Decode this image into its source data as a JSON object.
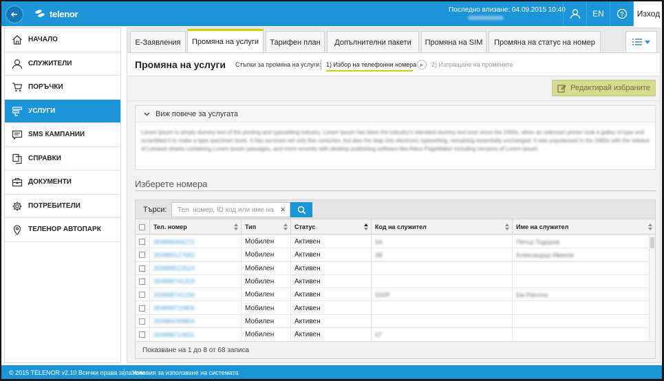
{
  "header": {
    "brand": "telenor",
    "last_login_label": "Последно влизане: 04.09.2015 10:40",
    "language": "EN",
    "logout_label": "Изход"
  },
  "sidebar": {
    "items": [
      {
        "label": "НАЧАЛО",
        "icon": "home-icon",
        "active": false
      },
      {
        "label": "СЛУЖИТЕЛИ",
        "icon": "user-icon",
        "active": false
      },
      {
        "label": "ПОРЪЧКИ",
        "icon": "cart-icon",
        "active": false
      },
      {
        "label": "УСЛУГИ",
        "icon": "services-icon",
        "active": true
      },
      {
        "label": "SMS КАМПАНИИ",
        "icon": "message-icon",
        "active": false
      },
      {
        "label": "СПРАВКИ",
        "icon": "documents-icon",
        "active": false
      },
      {
        "label": "ДОКУМЕНТИ",
        "icon": "briefcase-icon",
        "active": false
      },
      {
        "label": "ПОТРЕБИТЕЛИ",
        "icon": "gear-icon",
        "active": false
      },
      {
        "label": "ТЕЛЕНОР АВТОПАРК",
        "icon": "location-pin-icon",
        "active": false
      }
    ]
  },
  "tabs": [
    {
      "label": "Е-Заявления",
      "active": false
    },
    {
      "label": "Промяна на услуги",
      "active": true
    },
    {
      "label": "Тарифен план",
      "active": false
    },
    {
      "label": "Допълнителни пакети",
      "active": false
    },
    {
      "label": "Промяна на SIM",
      "active": false
    },
    {
      "label": "Промяна на статус на номер",
      "active": false
    }
  ],
  "page": {
    "title": "Промяна на услуги",
    "steps_label": "Стъпки за промяна на услуги:",
    "step1": "1) Избор на телефонни номера",
    "step2": "2) Изпращане на промените",
    "edit_button": "Редактирай избраните",
    "info_toggle": "Виж повече за услугата",
    "info_text": "Lorem Ipsum is simply dummy text of the printing and typesetting industry. Lorem Ipsum has been the industry's standard dummy text ever since the 1500s, when an unknown printer took a galley of type and scrambled it to make a type specimen book. It has survived not only five centuries, but also the leap into electronic typesetting, remaining essentially unchanged. It was popularised in the 1960s with the release of Letraset sheets containing Lorem Ipsum passages, and more recently with desktop publishing software like Aldus PageMaker including versions of Lorem Ipsum.",
    "select_title": "Изберете номера"
  },
  "search": {
    "label": "Търси:",
    "placeholder": "Тел. номер, ID код или име на"
  },
  "grid": {
    "columns": [
      "Тел. номер",
      "Тип",
      "Статус",
      "Код на служител",
      "Име на служител"
    ],
    "rows": [
      {
        "phone": "359888456272",
        "type": "Мобилен",
        "status": "Активен",
        "code": "5A",
        "name": "Петър Тодоров"
      },
      {
        "phone": "359889127683",
        "type": "Мобилен",
        "status": "Активен",
        "code": "3B",
        "name": "Александър Иванов"
      },
      {
        "phone": "359888023524",
        "type": "Мобилен",
        "status": "Активен",
        "code": "",
        "name": ""
      },
      {
        "phone": "359888741203",
        "type": "Мобилен",
        "status": "Активен",
        "code": "",
        "name": ""
      },
      {
        "phone": "359888741234",
        "type": "Мобилен",
        "status": "Активен",
        "code": "5S0P",
        "name": "Ем Petrova"
      },
      {
        "phone": "359888710805",
        "type": "Мобилен",
        "status": "Активен",
        "code": "",
        "name": ""
      },
      {
        "phone": "359884099804",
        "type": "Мобилен",
        "status": "Активен",
        "code": "",
        "name": ""
      },
      {
        "phone": "359888710831",
        "type": "Мобилен",
        "status": "Активен",
        "code": "07",
        "name": ""
      }
    ],
    "footer": "Показване на 1 до 8 от 68 записа"
  },
  "footer": {
    "copyright": "© 2015 TELENOR v2.10 Всички права запазени",
    "terms": "Условия за използване на системата"
  },
  "colors": {
    "primary": "#1c94d8",
    "accent": "#c8d400",
    "edit_button_bg": "#d6db92"
  }
}
